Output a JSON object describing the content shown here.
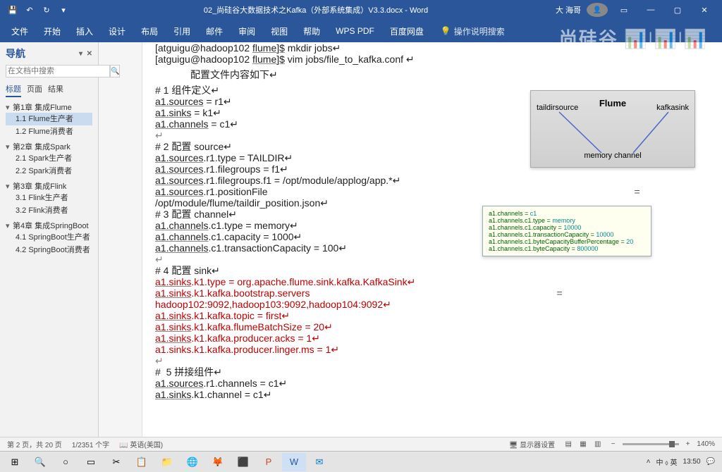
{
  "titlebar": {
    "title": "02_尚硅谷大数据技术之Kafka（外部系统集成）V3.3.docx - Word",
    "user": "大 海哥"
  },
  "menubar": {
    "tabs": [
      "文件",
      "开始",
      "插入",
      "设计",
      "布局",
      "引用",
      "邮件",
      "审阅",
      "视图",
      "帮助",
      "WPS PDF",
      "百度网盘"
    ],
    "tell": "操作说明搜索"
  },
  "nav": {
    "heading": "导航",
    "search_ph": "在文档中搜索",
    "tabs": [
      "标题",
      "页面",
      "结果"
    ],
    "chapters": [
      {
        "title": "第1章 集成Flume",
        "items": [
          "1.1 Flume生产者",
          "1.2 Flume消费者"
        ],
        "sel": 0
      },
      {
        "title": "第2章 集成Spark",
        "items": [
          "2.1 Spark生产者",
          "2.2 Spark消费者"
        ]
      },
      {
        "title": "第3章 集成Flink",
        "items": [
          "3.1 Flink生产者",
          "3.2 Flink消费者"
        ]
      },
      {
        "title": "第4章 集成SpringBoot",
        "items": [
          "4.1 SpringBoot生产者",
          "4.2 SpringBoot消费者"
        ]
      }
    ]
  },
  "doc": {
    "line0a": "[atguigu@hadoop102 ",
    "line0b": "flume]$",
    "line0c": " mkdir jobs↵",
    "line1a": "[atguigu@hadoop102 ",
    "line1b": "flume]$",
    "line1c": " vim jobs/file_to_kafka.conf ↵",
    "heading1": "配置文件内容如下↵",
    "c1": "# 1 组件定义↵",
    "l1a": "a1",
    "l1b": ".sources",
    "l1c": " = r1↵",
    "l2a": "a1",
    "l2b": ".sinks",
    "l2c": " = k1↵",
    "l3a": "a1",
    "l3b": ".channels",
    "l3c": " = c1↵",
    "blank1": "↵",
    "c2": "# 2 配置 source↵",
    "s1a": "a1",
    "s1b": ".sources",
    "s1c": ".r1.type = TAILDIR↵",
    "s2a": "a1",
    "s2b": ".sources",
    "s2c": ".r1.filegroups = f1↵",
    "s3a": "a1",
    "s3b": ".sources",
    "s3c": ".r1.filegroups.f1 = /opt/module/applog/app.*↵",
    "s4a": "a1",
    "s4b": ".sources",
    "s4c": ".r1.positionFile",
    "s4eq": "=",
    "s5": "/opt/module/flume/taildir_position.json↵",
    "c3": "# 3 配置 channel↵",
    "ch1a": "a1",
    "ch1b": ".channels",
    "ch1c": ".c1.type = memory↵",
    "ch2a": "a1",
    "ch2b": ".channels",
    "ch2c": ".c1.capacity = 1000↵",
    "ch3a": "a1",
    "ch3b": ".channels",
    "ch3c": ".c1.transactionCapacity = 100↵",
    "blank2": "↵",
    "c4": "# 4 配置 sink↵",
    "k1a": "a1",
    "k1b": ".sinks",
    "k1c": ".k1.type = org.apache.flume.sink.kafka.KafkaSink↵",
    "k2a": "a1",
    "k2b": ".sinks",
    "k2c": ".k1.kafka.bootstrap.servers",
    "k2eq": "=",
    "k3": "hadoop102:9092,hadoop103:9092,hadoop104:9092↵",
    "k4a": "a1",
    "k4b": ".sinks",
    "k4c": ".k1.kafka.topic = first↵",
    "k5a": "a1",
    "k5b": ".sinks",
    "k5c": ".k1.kafka.flumeBatchSize = 20↵",
    "k6a": "a1",
    "k6b": ".sinks",
    "k6c": ".k1.kafka.producer.acks = 1↵",
    "k7": "a1.sinks.k1.kafka.producer.linger.ms = 1↵",
    "blank3": "↵",
    "c5": "#  5 拼接组件↵",
    "p1a": "a1",
    "p1b": ".sources",
    "p1c": ".r1.channels = c1↵",
    "p2a": "a1",
    "p2b": ".sinks",
    "p2c": ".k1.channel = c1↵"
  },
  "diagram": {
    "title": "Flume",
    "src": "taildirsource",
    "sink": "kafkasink",
    "chan": "memory channel"
  },
  "tooltip": {
    "l1": "a1.channels = ",
    "l1v": "c1",
    "l2": "a1.channels.c1.type = ",
    "l2v": "memory",
    "l3": "a1.channels.c1.capacity = ",
    "l3v": "10000",
    "l4": "a1.channels.c1.transactionCapacity = ",
    "l4v": "10000",
    "l5": "a1.channels.c1.byteCapacityBufferPercentage = ",
    "l5v": "20",
    "l6": "a1.channels.c1.byteCapacity = ",
    "l6v": "800000"
  },
  "status": {
    "page": "第 2 页，共 20 页",
    "words": "1/2351 个字",
    "lang": "英语(美国)",
    "display": "显示器设置",
    "zoom": "140%"
  },
  "taskbar": {
    "tray_ime": "中 ⬨ 英",
    "tray_time": "13:50"
  },
  "watermark": "尚硅谷"
}
